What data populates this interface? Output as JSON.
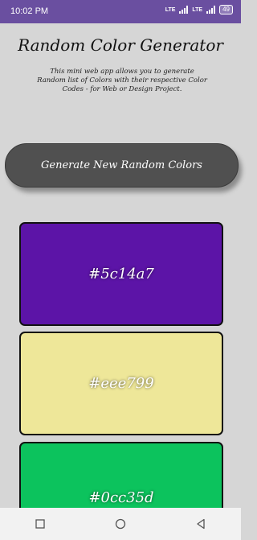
{
  "status_bar": {
    "time": "10:02 PM",
    "network_1": "LTE",
    "network_2": "LTE",
    "battery": "49"
  },
  "app": {
    "title": "Random Color Generator",
    "description": "This mini web app allows you to generate Random list of Colors with their respective Color Codes - for Web or Design Project.",
    "generate_button_label": "Generate New Random Colors"
  },
  "colors": [
    {
      "code": "#5c14a7",
      "hex": "#5c14a7"
    },
    {
      "code": "#eee799",
      "hex": "#eee799"
    },
    {
      "code": "#0cc35d",
      "hex": "#0cc35d"
    }
  ],
  "nav_bar": {
    "icons": [
      "recent-apps-icon",
      "home-icon",
      "back-icon"
    ]
  }
}
